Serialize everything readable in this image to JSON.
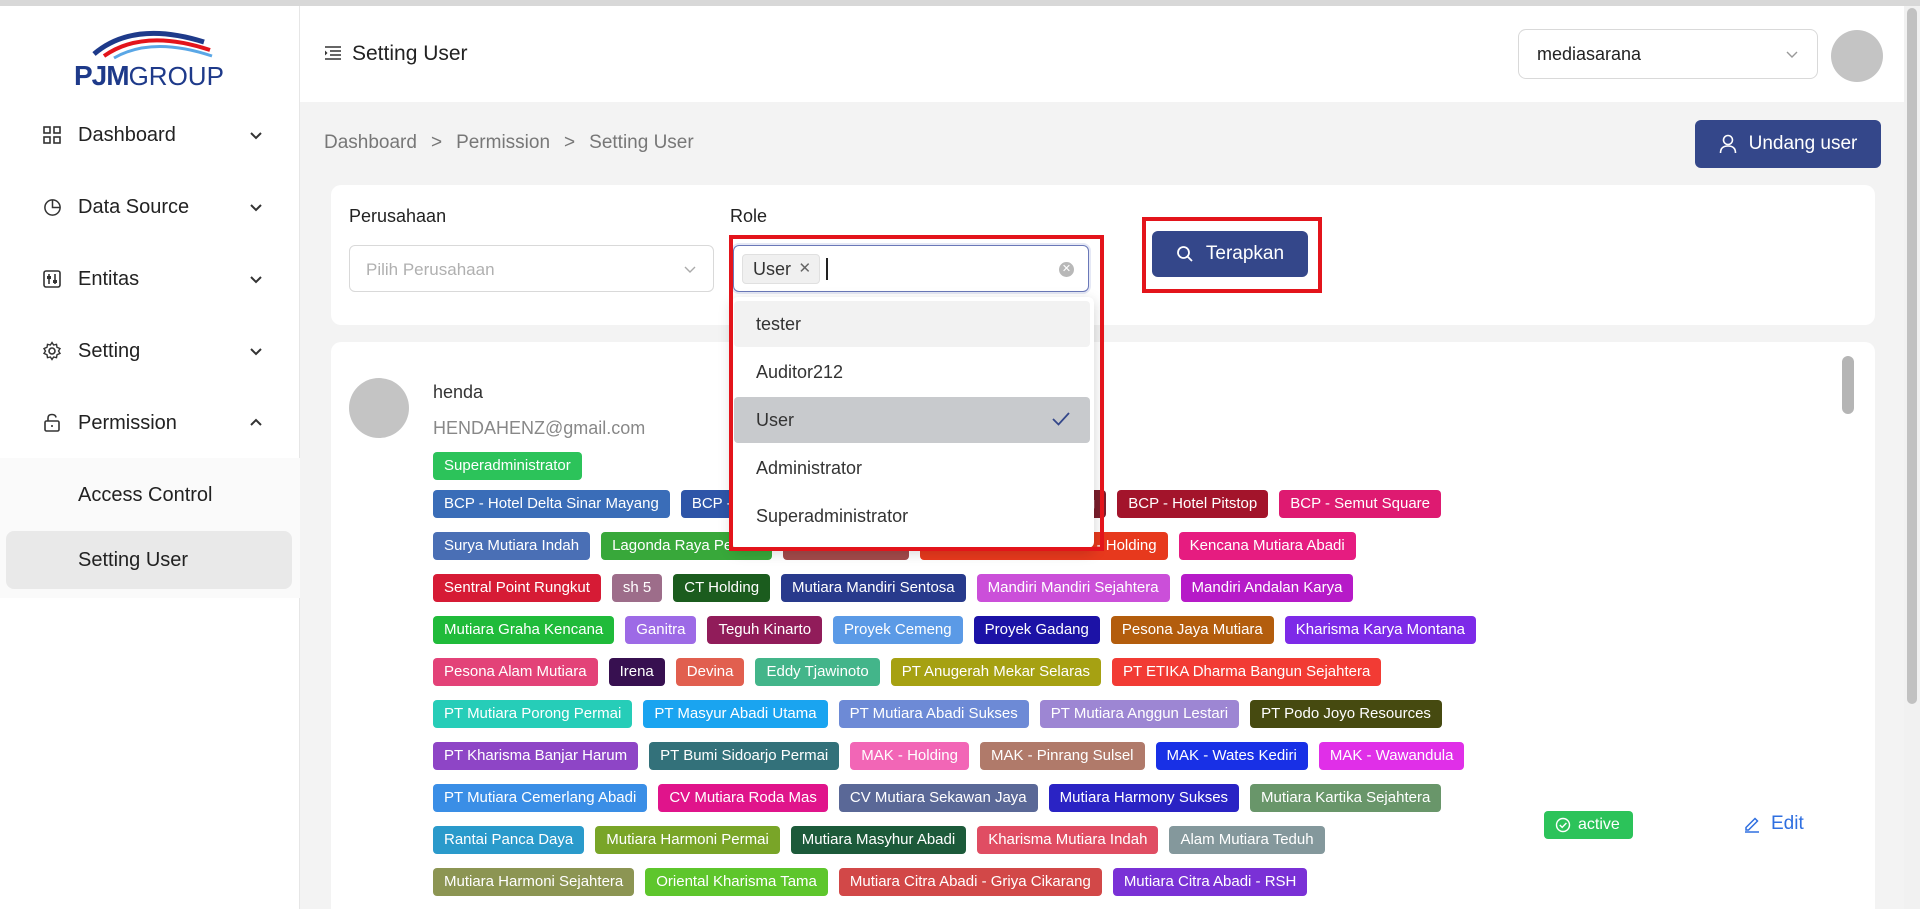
{
  "app": {
    "logo_strong": "PJM",
    "logo_light": "GROUP",
    "page_title": "Setting User"
  },
  "sidebar": {
    "items": [
      {
        "label": "Dashboard",
        "icon": "grid-icon"
      },
      {
        "label": "Data Source",
        "icon": "pie-chart-icon"
      },
      {
        "label": "Entitas",
        "icon": "sliders-icon"
      },
      {
        "label": "Setting",
        "icon": "gear-icon"
      },
      {
        "label": "Permission",
        "icon": "lock-icon"
      }
    ],
    "sub_items": [
      {
        "label": "Access Control"
      },
      {
        "label": "Setting User"
      }
    ]
  },
  "header": {
    "org_value": "mediasarana"
  },
  "breadcrumb": [
    "Dashboard",
    ">",
    "Permission",
    ">",
    "Setting User"
  ],
  "invite_button": "Undang user",
  "filter": {
    "company_label": "Perusahaan",
    "company_placeholder": "Pilih Perusahaan",
    "role_label": "Role",
    "role_selected": "User",
    "apply_label": "Terapkan",
    "role_options": [
      "tester",
      "Auditor212",
      "User",
      "Administrator",
      "Superadministrator"
    ]
  },
  "user": {
    "name": "henda",
    "email": "HENDAHENZ@gmail.com",
    "role": "Superadministrator",
    "status": "active",
    "edit_label": "Edit",
    "tag_rows": [
      [
        {
          "text": "BCP - Hotel Delta Sinar Mayang",
          "color": "#3a6db8"
        },
        {
          "text": "BCP - Hotel Arthama Semut",
          "color": "#2e55a8"
        },
        {
          "text": "BCP - Hotel Pitstop Holding",
          "color": "#7b1e2c"
        },
        {
          "text": "BCP - Hotel Pitstop",
          "color": "#a3142b"
        },
        {
          "text": "BCP - Semut Square",
          "color": "#de1a71"
        }
      ],
      [
        {
          "text": "Surya Mutiara Indah",
          "color": "#4a6fb5"
        },
        {
          "text": "Lagonda Raya Permai",
          "color": "#38a83a"
        },
        {
          "text": "Mutiara Mandiri",
          "color": "#a34a4a"
        },
        {
          "text": "Mutiara Mandiri Makmur - Holding",
          "color": "#e7391d"
        },
        {
          "text": "Kencana Mutiara Abadi",
          "color": "#e61c80"
        }
      ],
      [
        {
          "text": "Sentral Point Rungkut",
          "color": "#d61b35"
        },
        {
          "text": "sh 5",
          "color": "#9d6d8a"
        },
        {
          "text": "CT Holding",
          "color": "#1b5c1e"
        },
        {
          "text": "Mutiara Mandiri Sentosa",
          "color": "#283a8c"
        },
        {
          "text": "Mandiri Mandiri Sejahtera",
          "color": "#cb4fd9"
        },
        {
          "text": "Mandiri Andalan Karya",
          "color": "#b61ac8"
        }
      ],
      [
        {
          "text": "Mutiara Graha Kencana",
          "color": "#20bb3a"
        },
        {
          "text": "Ganitra",
          "color": "#9d6ae6"
        },
        {
          "text": "Teguh Kinarto",
          "color": "#911c5a"
        },
        {
          "text": "Proyek Cemeng",
          "color": "#5b9ae6"
        },
        {
          "text": "Proyek Gadang",
          "color": "#1c12a6"
        },
        {
          "text": "Pesona Jaya Mutiara",
          "color": "#b35d0d"
        },
        {
          "text": "Kharisma Karya Montana",
          "color": "#7d2ae8"
        }
      ],
      [
        {
          "text": "Pesona Alam Mutiara",
          "color": "#e34278"
        },
        {
          "text": "Irena",
          "color": "#371050"
        },
        {
          "text": "Devina",
          "color": "#e15f4f"
        },
        {
          "text": "Eddy Tjawinoto",
          "color": "#43b58a"
        },
        {
          "text": "PT Anugerah Mekar Selaras",
          "color": "#a6a112"
        },
        {
          "text": "PT ETIKA Dharma Bangun Sejahtera",
          "color": "#f23b34"
        }
      ],
      [
        {
          "text": "PT Mutiara Porong Permai",
          "color": "#26cdb8"
        },
        {
          "text": "PT Masyur Abadi Utama",
          "color": "#1aa4f0"
        },
        {
          "text": "PT Mutiara Abadi Sukses",
          "color": "#6d8ad6"
        },
        {
          "text": "PT Mutiara Anggun Lestari",
          "color": "#9d86d3"
        },
        {
          "text": "PT Podo Joyo Resources",
          "color": "#464a10"
        }
      ],
      [
        {
          "text": "PT Kharisma Banjar Harum",
          "color": "#8e45c6"
        },
        {
          "text": "PT Bumi Sidoarjo Permai",
          "color": "#33717a"
        },
        {
          "text": "MAK - Holding",
          "color": "#f266b6"
        },
        {
          "text": "MAK - Pinrang Sulsel",
          "color": "#b07a6a"
        },
        {
          "text": "MAK - Wates Kediri",
          "color": "#1830e6"
        },
        {
          "text": "MAK - Wawandula",
          "color": "#e02fe8"
        }
      ],
      [
        {
          "text": "PT Mutiara Cemerlang Abadi",
          "color": "#3a8ee6"
        },
        {
          "text": "CV Mutiara Roda Mas",
          "color": "#e0148b"
        },
        {
          "text": "CV Mutiara Sekawan Jaya",
          "color": "#5a6897"
        },
        {
          "text": "Mutiara Harmony Sukses",
          "color": "#2a23c4"
        },
        {
          "text": "Mutiara Kartika Sejahtera",
          "color": "#69966a"
        }
      ],
      [
        {
          "text": "Rantai Panca Daya",
          "color": "#2a9acb"
        },
        {
          "text": "Mutiara Harmoni Permai",
          "color": "#79a528"
        },
        {
          "text": "Mutiara Masyhur Abadi",
          "color": "#1c5a3a"
        },
        {
          "text": "Kharisma Mutiara Indah",
          "color": "#e04d63"
        },
        {
          "text": "Alam Mutiara Teduh",
          "color": "#84989c"
        }
      ],
      [
        {
          "text": "Mutiara Harmoni Sejahtera",
          "color": "#8c9553"
        },
        {
          "text": "Oriental Kharisma Tama",
          "color": "#5ec62c"
        },
        {
          "text": "Mutiara Citra Abadi - Griya Cikarang",
          "color": "#d24848"
        },
        {
          "text": "Mutiara Citra Abadi - RSH",
          "color": "#7a31d6"
        }
      ]
    ]
  },
  "colors": {
    "primary": "#34478a",
    "success": "#2cc35a",
    "link": "#2f6fe0",
    "highlight": "#e3141b"
  }
}
